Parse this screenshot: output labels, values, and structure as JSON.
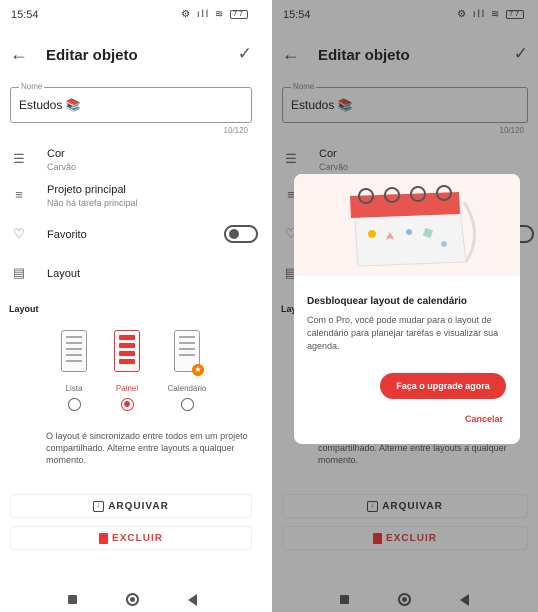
{
  "status": {
    "time": "15:54",
    "battery": "77"
  },
  "appbar": {
    "title": "Editar objeto"
  },
  "name_field": {
    "label": "Nome",
    "value": "Estudos 📚",
    "counter": "10/120"
  },
  "settings": {
    "color": {
      "title": "Cor",
      "value": "Carvão"
    },
    "project": {
      "title": "Projeto principal",
      "value": "Não há tarefa principal"
    },
    "favorite": {
      "title": "Favorito",
      "on": false
    },
    "layout": {
      "title": "Layout"
    }
  },
  "layout_section": {
    "title": "Layout",
    "options": [
      {
        "label": "Lista",
        "selected": false
      },
      {
        "label": "Painel",
        "selected": true
      },
      {
        "label": "Calendário",
        "selected": false
      }
    ],
    "note": "O layout é sincronizado entre todos em um projeto compartilhado. Alterne entre layouts a qualquer momento."
  },
  "actions": {
    "archive": "ARQUIVAR",
    "delete": "EXCLUIR"
  },
  "dialog": {
    "title": "Desbloquear layout de calendário",
    "body": "Com o Pro, você pode mudar para o layout de calendário para planejar tarefas e visualizar sua agenda.",
    "upgrade": "Faça o upgrade agora",
    "cancel": "Cancelar"
  },
  "colors": {
    "accent": "#e53935",
    "scrim": "#1e1e1e"
  },
  "icons": [
    "back-arrow-icon",
    "check-icon",
    "palette-icon",
    "project-icon",
    "heart-icon",
    "layout-icon",
    "archive-icon",
    "trash-icon",
    "star-icon"
  ]
}
